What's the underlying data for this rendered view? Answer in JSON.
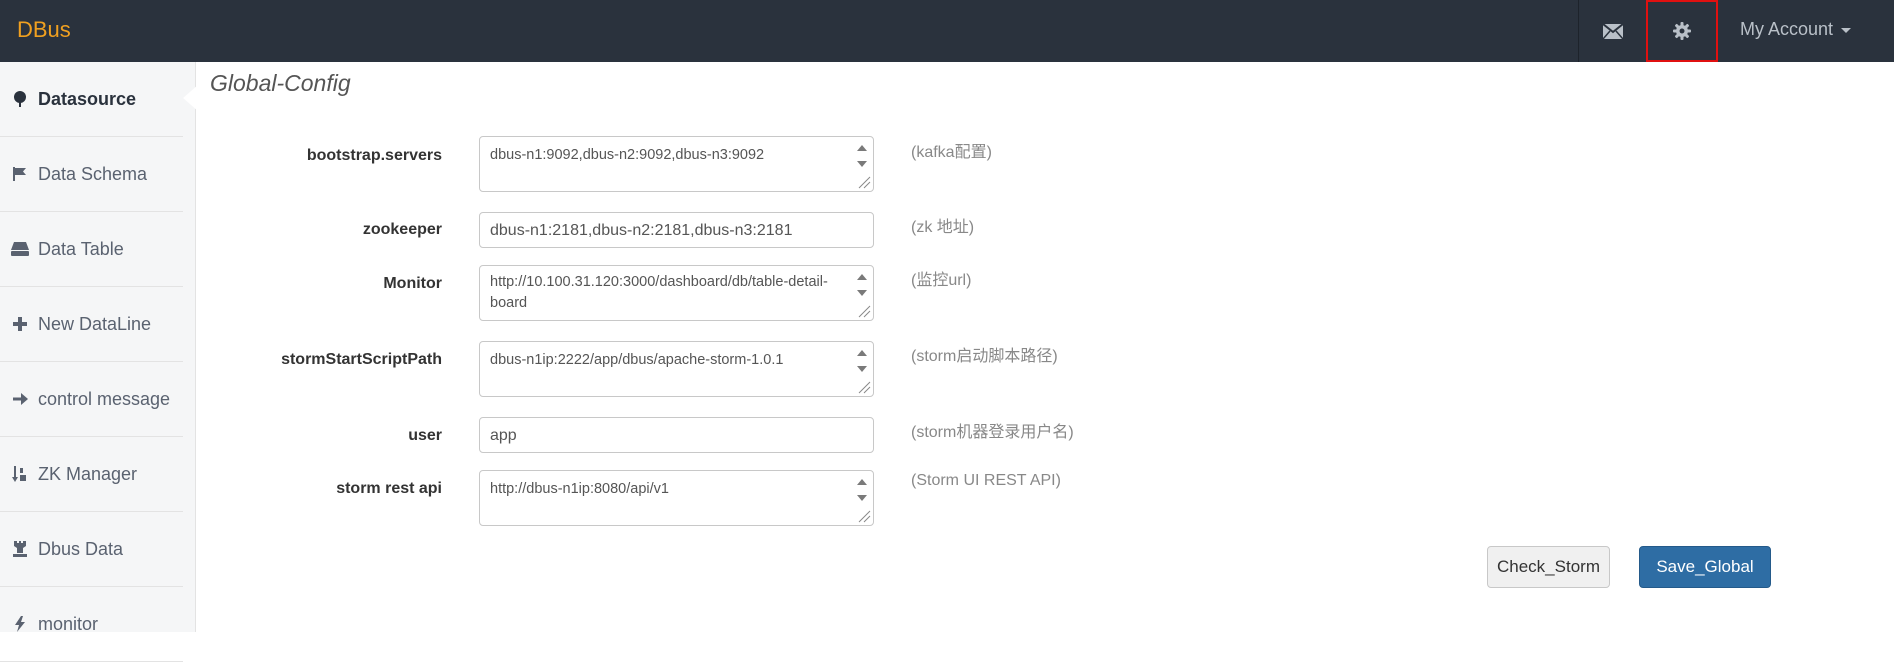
{
  "navbar": {
    "brand": "DBus",
    "mail_icon": "envelope-icon",
    "settings_icon": "gear-icon",
    "account_label": "My Account",
    "brand_color": "#f0a020",
    "highlight_color": "#e01010"
  },
  "sidebar": {
    "items": [
      {
        "label": "Datasource",
        "icon": "tree-icon",
        "active": true
      },
      {
        "label": "Data Schema",
        "icon": "flag-icon"
      },
      {
        "label": "Data Table",
        "icon": "hdd-icon"
      },
      {
        "label": "New DataLine",
        "icon": "plus-icon"
      },
      {
        "label": "control message",
        "icon": "arrow-right-icon"
      },
      {
        "label": "ZK Manager",
        "icon": "sort-icon"
      },
      {
        "label": "Dbus Data",
        "icon": "tower-icon"
      },
      {
        "label": "monitor",
        "icon": "flash-icon"
      }
    ]
  },
  "main": {
    "title": "Global-Config",
    "fields": [
      {
        "label": "bootstrap.servers",
        "value": "dbus-n1:9092,dbus-n2:9092,dbus-n3:9092",
        "hint": "(kafka配置)"
      },
      {
        "label": "zookeeper",
        "value": "dbus-n1:2181,dbus-n2:2181,dbus-n3:2181",
        "hint": "(zk 地址)"
      },
      {
        "label": "Monitor",
        "value": "http://10.100.31.120:3000/dashboard/db/table-detail-board",
        "hint": "(监控url)"
      },
      {
        "label": "stormStartScriptPath",
        "value": "dbus-n1ip:2222/app/dbus/apache-storm-1.0.1",
        "hint": "(storm启动脚本路径)"
      },
      {
        "label": "user",
        "value": "app",
        "hint": "(storm机器登录用户名)"
      },
      {
        "label": "storm rest api",
        "value": "http://dbus-n1ip:8080/api/v1",
        "hint": "(Storm UI REST API)"
      }
    ],
    "check_button": "Check_Storm",
    "save_button": "Save_Global"
  }
}
